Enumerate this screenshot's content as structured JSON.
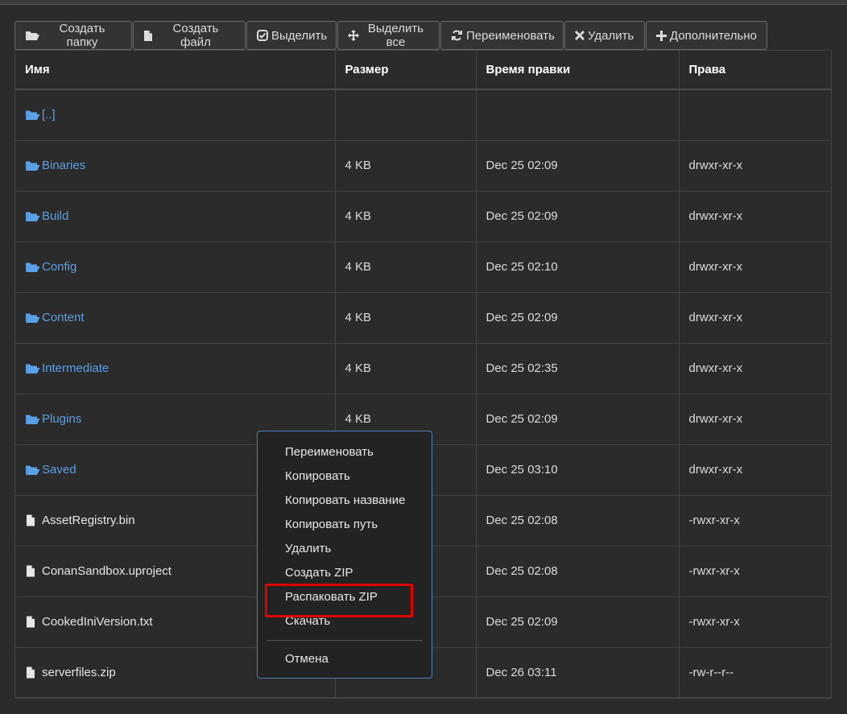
{
  "toolbar": {
    "create_folder": "Создать папку",
    "create_file": "Создать файл",
    "select": "Выделить",
    "select_all": "Выделить все",
    "rename": "Переименовать",
    "delete": "Удалить",
    "more": "Дополнительно"
  },
  "table": {
    "headers": [
      "Имя",
      "Размер",
      "Время правки",
      "Права"
    ],
    "rows": [
      {
        "name": "[..]",
        "size": "",
        "mtime": "",
        "perms": "",
        "type": "dir"
      },
      {
        "name": "Binaries",
        "size": "4 KB",
        "mtime": "Dec 25 02:09",
        "perms": "drwxr-xr-x",
        "type": "dir"
      },
      {
        "name": "Build",
        "size": "4 KB",
        "mtime": "Dec 25 02:09",
        "perms": "drwxr-xr-x",
        "type": "dir"
      },
      {
        "name": "Config",
        "size": "4 KB",
        "mtime": "Dec 25 02:10",
        "perms": "drwxr-xr-x",
        "type": "dir"
      },
      {
        "name": "Content",
        "size": "4 KB",
        "mtime": "Dec 25 02:09",
        "perms": "drwxr-xr-x",
        "type": "dir"
      },
      {
        "name": "Intermediate",
        "size": "4 KB",
        "mtime": "Dec 25 02:35",
        "perms": "drwxr-xr-x",
        "type": "dir"
      },
      {
        "name": "Plugins",
        "size": "4 KB",
        "mtime": "Dec 25 02:09",
        "perms": "drwxr-xr-x",
        "type": "dir"
      },
      {
        "name": "Saved",
        "size": "",
        "mtime": "Dec 25 03:10",
        "perms": "drwxr-xr-x",
        "type": "dir"
      },
      {
        "name": "AssetRegistry.bin",
        "size": "",
        "mtime": "Dec 25 02:08",
        "perms": "-rwxr-xr-x",
        "type": "file"
      },
      {
        "name": "ConanSandbox.uproject",
        "size": "",
        "mtime": "Dec 25 02:08",
        "perms": "-rwxr-xr-x",
        "type": "file"
      },
      {
        "name": "CookedIniVersion.txt",
        "size": "",
        "mtime": "Dec 25 02:09",
        "perms": "-rwxr-xr-x",
        "type": "file"
      },
      {
        "name": "serverfiles.zip",
        "size": "",
        "mtime": "Dec 26 03:11",
        "perms": "-rw-r--r--",
        "type": "file"
      }
    ]
  },
  "context_menu": {
    "items": [
      "Переименовать",
      "Копировать",
      "Копировать название",
      "Копировать путь",
      "Удалить",
      "Создать ZIP",
      "Распаковать ZIP",
      "Скачать"
    ],
    "cancel": "Отмена",
    "highlighted_index": 6
  },
  "colors": {
    "background": "#2b2b2b",
    "link": "#5aa0e6",
    "menu_border": "#4e7fb8",
    "highlight": "#e00000"
  },
  "icons": {
    "dir": "folder-open-icon",
    "file": "file-icon"
  }
}
